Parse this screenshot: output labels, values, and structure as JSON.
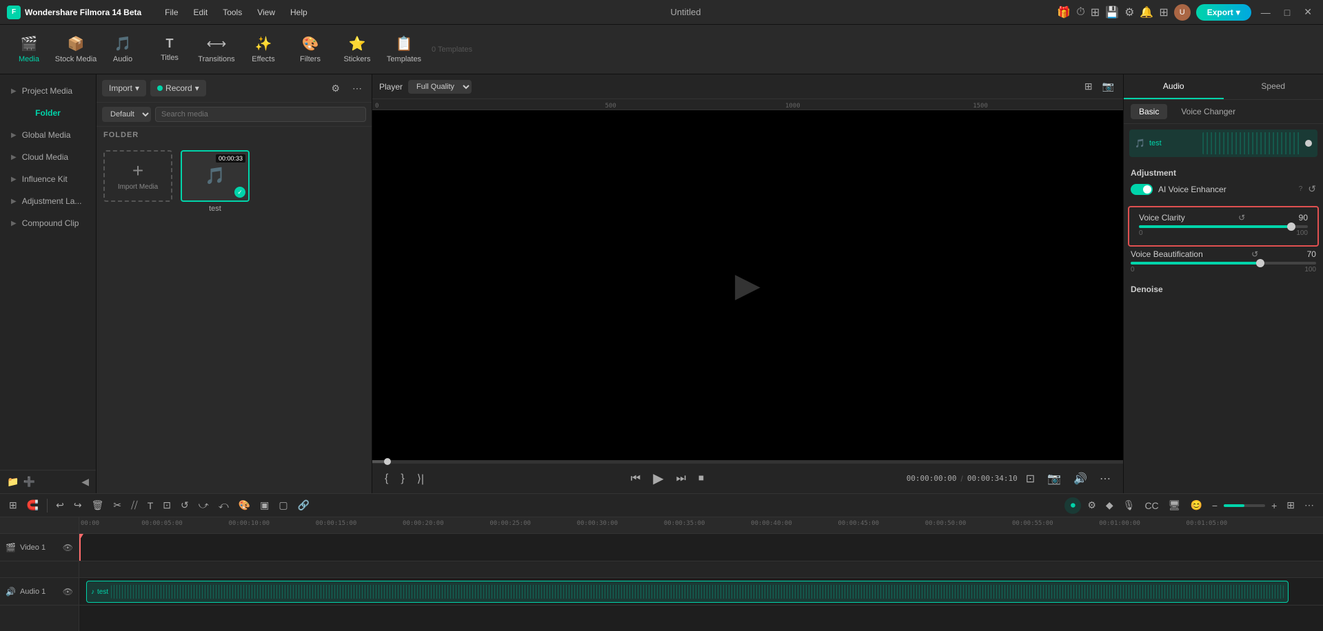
{
  "app": {
    "name": "Wondershare Filmora 14 Beta",
    "title": "Untitled",
    "logo_text": "F"
  },
  "menu": {
    "items": [
      "File",
      "Edit",
      "Tools",
      "View",
      "Help"
    ]
  },
  "toolbar": {
    "items": [
      {
        "id": "media",
        "label": "Media",
        "icon": "🎬",
        "active": true
      },
      {
        "id": "stock",
        "label": "Stock Media",
        "icon": "📦"
      },
      {
        "id": "audio",
        "label": "Audio",
        "icon": "🎵"
      },
      {
        "id": "titles",
        "label": "Titles",
        "icon": "T"
      },
      {
        "id": "transitions",
        "label": "Transitions",
        "icon": "⟷"
      },
      {
        "id": "effects",
        "label": "Effects",
        "icon": "✨"
      },
      {
        "id": "filters",
        "label": "Filters",
        "icon": "🎨"
      },
      {
        "id": "stickers",
        "label": "Stickers",
        "icon": "⭐"
      },
      {
        "id": "templates",
        "label": "Templates",
        "icon": "📋"
      }
    ],
    "export_label": "Export"
  },
  "sidebar": {
    "items": [
      {
        "id": "project-media",
        "label": "Project Media"
      },
      {
        "id": "folder",
        "label": "Folder",
        "active": true
      },
      {
        "id": "global-media",
        "label": "Global Media"
      },
      {
        "id": "cloud-media",
        "label": "Cloud Media"
      },
      {
        "id": "influence-kit",
        "label": "Influence Kit"
      },
      {
        "id": "adjustment-la",
        "label": "Adjustment La..."
      },
      {
        "id": "compound-clip",
        "label": "Compound Clip"
      }
    ]
  },
  "media_panel": {
    "import_label": "Import",
    "record_label": "Record",
    "default_label": "Default",
    "search_placeholder": "Search media",
    "folder_label": "FOLDER",
    "import_media_label": "Import Media",
    "items": [
      {
        "name": "test",
        "duration": "00:00:33",
        "selected": true,
        "has_check": true
      }
    ]
  },
  "player": {
    "label": "Player",
    "quality": "Full Quality",
    "current_time": "00:00:00:00",
    "total_time": "00:00:34:10",
    "progress_pct": 2
  },
  "timeline": {
    "ruler_marks": [
      "00:00",
      "00:00:05:00",
      "00:00:10:00",
      "00:00:15:00",
      "00:00:20:00",
      "00:00:25:00",
      "00:00:30:00",
      "00:00:35:00",
      "00:00:40:00",
      "00:00:45:00",
      "00:00:50:00",
      "00:00:55:00",
      "00:01:00:00",
      "00:01:05:00"
    ],
    "tracks": [
      {
        "id": "video1",
        "name": "Video 1",
        "type": "video"
      },
      {
        "id": "audio1",
        "name": "Audio 1",
        "type": "audio",
        "clip": {
          "name": "test",
          "icon": "♪"
        }
      }
    ]
  },
  "right_panel": {
    "tabs": [
      "Audio",
      "Speed"
    ],
    "active_tab": "Audio",
    "sub_tabs": [
      "Basic",
      "Voice Changer"
    ],
    "active_sub_tab": "Basic",
    "audio_name": "test",
    "adjustment_title": "Adjustment",
    "ai_voice_enhancer_label": "AI Voice Enhancer",
    "voice_clarity": {
      "label": "Voice Clarity",
      "value": 90,
      "min": 0,
      "max": 100,
      "pct": 90
    },
    "voice_beautification": {
      "label": "Voice Beautification",
      "value": 70,
      "min": 0,
      "max": 100,
      "pct": 70
    },
    "denoise": {
      "label": "Denoise"
    }
  },
  "window_controls": {
    "minimize": "—",
    "maximize": "□",
    "close": "✕"
  }
}
